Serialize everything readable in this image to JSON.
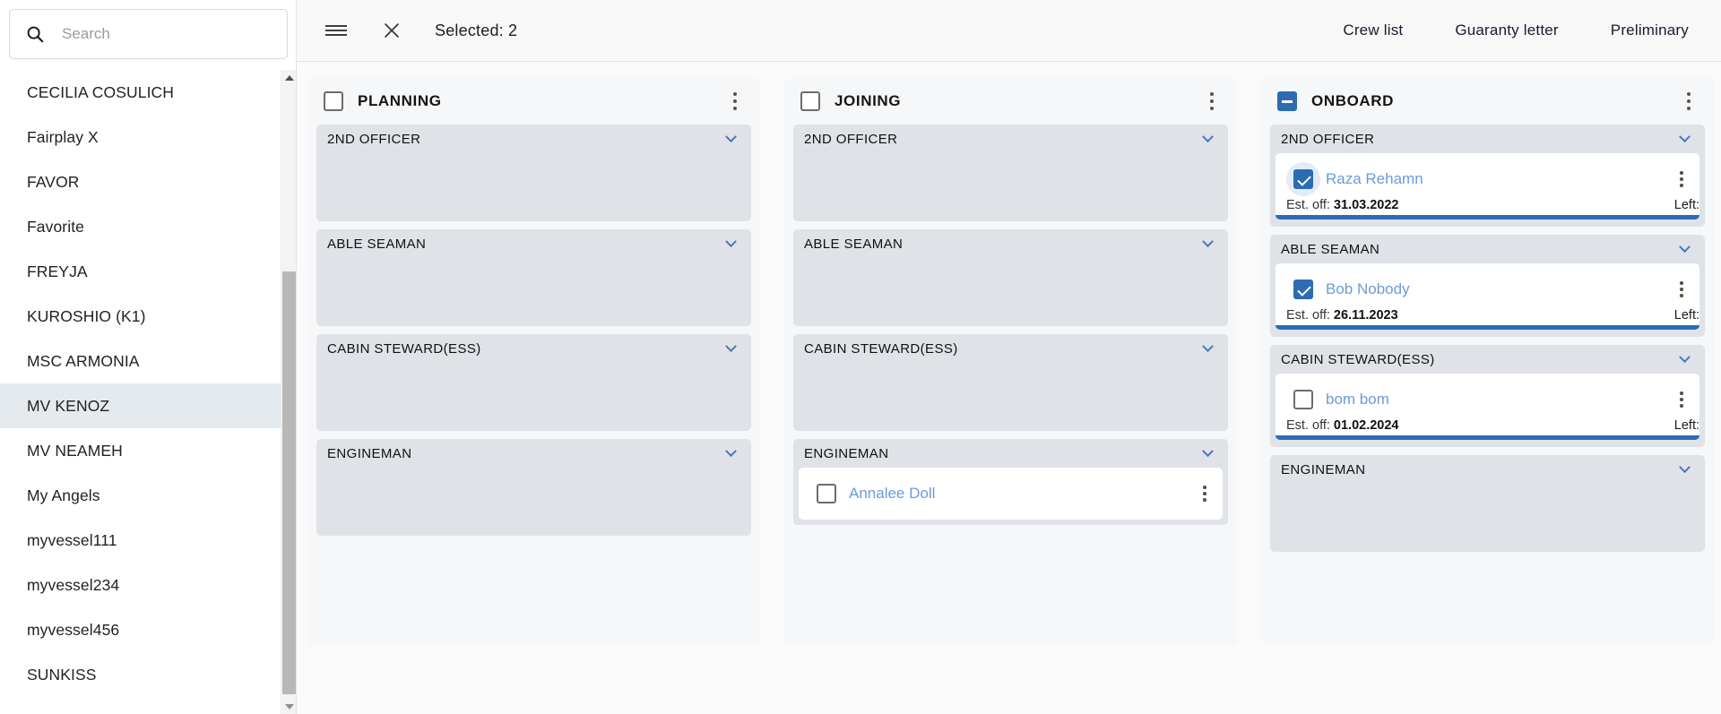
{
  "sidebar": {
    "search": {
      "placeholder": "Search",
      "value": "",
      "icon": "search-icon"
    },
    "items": [
      {
        "label": "CECILIA COSULICH",
        "selected": false
      },
      {
        "label": "Fairplay X",
        "selected": false
      },
      {
        "label": "FAVOR",
        "selected": false
      },
      {
        "label": "Favorite",
        "selected": false
      },
      {
        "label": "FREYJA",
        "selected": false
      },
      {
        "label": "KUROSHIO (K1)",
        "selected": false
      },
      {
        "label": "MSC ARMONIA",
        "selected": false
      },
      {
        "label": "MV KENOZ",
        "selected": true
      },
      {
        "label": "MV NEAMEH",
        "selected": false
      },
      {
        "label": "My Angels",
        "selected": false
      },
      {
        "label": "myvessel111",
        "selected": false
      },
      {
        "label": "myvessel234",
        "selected": false
      },
      {
        "label": "myvessel456",
        "selected": false
      },
      {
        "label": "SUNKISS",
        "selected": false
      }
    ]
  },
  "topbar": {
    "menu_icon": "hamburger-menu-icon",
    "close_icon": "close-icon",
    "selected_text": "Selected: 2",
    "actions": [
      {
        "label": "Crew list"
      },
      {
        "label": "Guaranty letter"
      },
      {
        "label": "Preliminary"
      }
    ]
  },
  "colors": {
    "accent": "#2b6cb4",
    "link": "#6d9adb",
    "column_bg": "#f5f7f9",
    "rank_bg": "#dfe2e7",
    "sidebar_selected": "#e5eaee"
  },
  "board": {
    "columns": [
      {
        "title": "PLANNING",
        "checkbox_state": "unchecked",
        "groups": [
          {
            "rank": "2ND OFFICER",
            "expanded": true,
            "cards": []
          },
          {
            "rank": "ABLE SEAMAN",
            "expanded": true,
            "cards": []
          },
          {
            "rank": "CABIN STEWARD(ESS)",
            "expanded": true,
            "cards": []
          },
          {
            "rank": "ENGINEMAN",
            "expanded": true,
            "cards": []
          }
        ]
      },
      {
        "title": "JOINING",
        "checkbox_state": "unchecked",
        "groups": [
          {
            "rank": "2ND OFFICER",
            "expanded": true,
            "cards": []
          },
          {
            "rank": "ABLE SEAMAN",
            "expanded": true,
            "cards": []
          },
          {
            "rank": "CABIN STEWARD(ESS)",
            "expanded": true,
            "cards": []
          },
          {
            "rank": "ENGINEMAN",
            "expanded": true,
            "cards": [
              {
                "name": "Annalee Doll",
                "checked": false,
                "ring": false,
                "has_meta": false,
                "est_off_label": "",
                "est_off_date": "",
                "left_label": "",
                "progress": 0
              }
            ]
          }
        ]
      },
      {
        "title": "ONBOARD",
        "checkbox_state": "indeterminate",
        "groups": [
          {
            "rank": "2ND OFFICER",
            "expanded": true,
            "cards": [
              {
                "name": "Raza Rehamn",
                "checked": true,
                "ring": true,
                "has_meta": true,
                "est_off_label": "Est. off:",
                "est_off_date": "31.03.2022",
                "left_label": "Left:",
                "progress": 100
              }
            ]
          },
          {
            "rank": "ABLE SEAMAN",
            "expanded": true,
            "cards": [
              {
                "name": "Bob Nobody",
                "checked": true,
                "ring": false,
                "has_meta": true,
                "est_off_label": "Est. off:",
                "est_off_date": "26.11.2023",
                "left_label": "Left:",
                "progress": 100
              }
            ]
          },
          {
            "rank": "CABIN STEWARD(ESS)",
            "expanded": true,
            "cards": [
              {
                "name": "bom bom",
                "checked": false,
                "ring": false,
                "has_meta": true,
                "est_off_label": "Est. off:",
                "est_off_date": "01.02.2024",
                "left_label": "Left:",
                "progress": 100
              }
            ]
          },
          {
            "rank": "ENGINEMAN",
            "expanded": true,
            "cards": []
          }
        ]
      }
    ]
  }
}
